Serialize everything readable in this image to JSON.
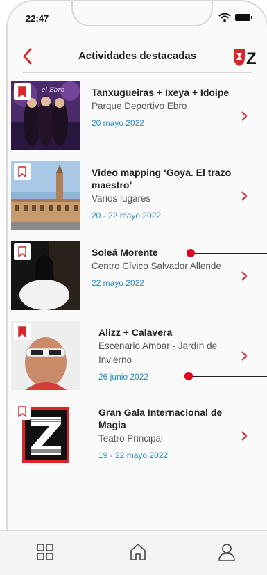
{
  "status_bar": {
    "time": "22:47"
  },
  "header": {
    "title": "Actividades destacadas",
    "back_icon": "chevron-left-icon",
    "logo_icon": "zaragoza-shield-logo",
    "logo_letter": "Z"
  },
  "events": [
    {
      "title": "Tanxugueiras + Ixeya + Idoipe",
      "place": "Parque Deportivo Ebro",
      "date": "20 mayo 2022",
      "bookmarked": true
    },
    {
      "title": "Video mapping ‘Goya. El trazo maestro’",
      "place": "Varios lugares",
      "date": "20 - 22 mayo 2022",
      "bookmarked": false
    },
    {
      "title": "Soleá Morente",
      "place": "Centro Cívico Salvador Allende",
      "date": "22 mayo 2022",
      "bookmarked": false
    },
    {
      "title": "Alizz + Calavera",
      "place": "Escenario Ambar - Jardín de Invierno",
      "date": "26 junio 2022",
      "bookmarked": true
    },
    {
      "title": "Gran Gala Internacional de Magia",
      "place": "Teatro Principal",
      "date": "19 - 22 mayo 2022",
      "bookmarked": false
    }
  ],
  "tabbar": {
    "items": [
      "grid-icon",
      "home-icon",
      "user-icon"
    ]
  },
  "colors": {
    "accent_red": "#d9262a",
    "date_blue": "#2a8bc2",
    "annotation_red": "#e0001b"
  }
}
